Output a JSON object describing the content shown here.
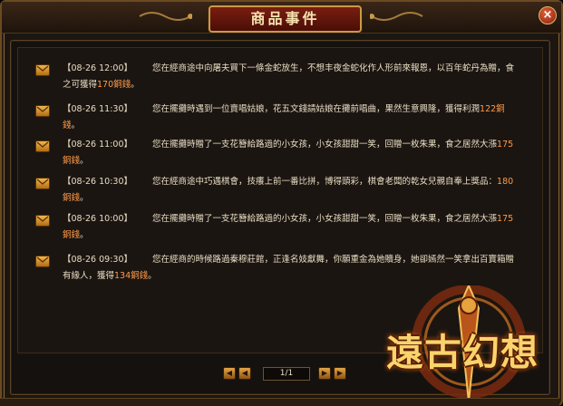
{
  "window": {
    "title": "商品事件",
    "close_label": "×"
  },
  "events": [
    {
      "time": "【08-26 12:00】",
      "text": "您在經商途中向屠夫買下一條金蛇放生，不想丰夜金蛇化作人形前來報恩，以百年蛇丹為贈，食之可獲得",
      "amount": "170",
      "unit": "銅錢",
      "suffix": "。"
    },
    {
      "time": "【08-26 11:30】",
      "text": "您在擺攤時遇到一位賣唱姑娘，花五文錢請姑娘在攤前唱曲，果然生意興隆，獲得利潤",
      "amount": "122",
      "unit": "銅錢",
      "suffix": "。"
    },
    {
      "time": "【08-26 11:00】",
      "text": "您在擺攤時贈了一支花簪給路過的小女孩，小女孩甜甜一笑，回贈一枚朱果，食之居然大漲",
      "amount": "175",
      "unit": "銅錢",
      "suffix": "。"
    },
    {
      "time": "【08-26 10:30】",
      "text": "您在經商途中巧遇棋會，技癢上前一番比拼，博得頭彩，棋會老闆的乾女兒親自奉上獎品：",
      "amount": "180",
      "unit": "銅錢",
      "suffix": "。"
    },
    {
      "time": "【08-26 10:00】",
      "text": "您在擺攤時贈了一支花簪給路過的小女孩，小女孩甜甜一笑，回贈一枚朱果，食之居然大漲",
      "amount": "175",
      "unit": "銅錢",
      "suffix": "。"
    },
    {
      "time": "【08-26 09:30】",
      "text": "您在經商的時候路過秦穆莊館，正逢名妓獻舞，你願重金為她贖身，她卻嫣然一笑拿出百寶箱贈有緣人，獲得",
      "amount": "134",
      "unit": "銅錢",
      "suffix": "。"
    }
  ],
  "pager": {
    "page": "1/1",
    "first_icon": "first-page-icon",
    "prev_icon": "prev-page-icon",
    "next_icon": "next-page-icon",
    "last_icon": "last-page-icon"
  },
  "logo": {
    "text": "遠古幻想"
  },
  "colors": {
    "accent": "#ff9a4a",
    "text": "#e9dcc3",
    "title": "#f6e3b0",
    "frame": "#8a6630"
  }
}
